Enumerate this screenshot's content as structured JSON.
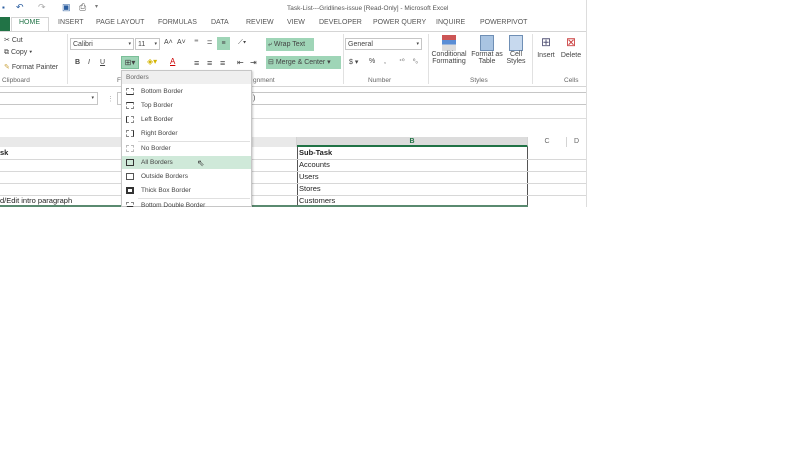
{
  "window": {
    "title": "Task-List---Gridlines-issue [Read-Only] - Microsoft Excel"
  },
  "tabs": [
    "HOME",
    "INSERT",
    "PAGE LAYOUT",
    "FORMULAS",
    "DATA",
    "REVIEW",
    "VIEW",
    "DEVELOPER",
    "POWER QUERY",
    "INQUIRE",
    "POWERPIVOT"
  ],
  "clipboard": {
    "cut": "Cut",
    "copy": "Copy",
    "format_painter": "Format Painter",
    "label": "Clipboard"
  },
  "font": {
    "name": "Calibri",
    "size": "11",
    "bold": "B",
    "italic": "I",
    "underline": "U",
    "label": "F"
  },
  "alignment": {
    "wrap": "Wrap Text",
    "merge": "Merge & Center",
    "label": "gnment"
  },
  "number": {
    "format": "General",
    "currency": "$",
    "percent": "%",
    "comma": ",",
    "label": "Number"
  },
  "styles": {
    "conditional": [
      "Conditional",
      "Formatting"
    ],
    "format_table": [
      "Format as",
      "Table"
    ],
    "cell_styles": [
      "Cell",
      "Styles"
    ],
    "label": "Styles"
  },
  "cells": {
    "insert": "Insert",
    "delete": "Delete",
    "label": "Cells"
  },
  "formula_bar": {
    "content": ")"
  },
  "sheet": {
    "columns": [
      "B",
      "C",
      "D"
    ],
    "col_a": [
      "sk",
      "",
      "",
      "",
      "d/Edit intro paragraph"
    ],
    "col_b": [
      "Sub-Task",
      "Accounts",
      "Users",
      "Stores",
      "Customers"
    ]
  },
  "borders_menu": {
    "header": "Borders",
    "items": [
      "Bottom Border",
      "Top Border",
      "Left Border",
      "Right Border",
      "No Border",
      "All Borders",
      "Outside Borders",
      "Thick Box Border",
      "Bottom Double Border"
    ],
    "highlighted": "All Borders"
  },
  "colors": {
    "accent": "#217346",
    "highlight": "#cfe9d9",
    "selected_btn": "#9fd5b7"
  }
}
